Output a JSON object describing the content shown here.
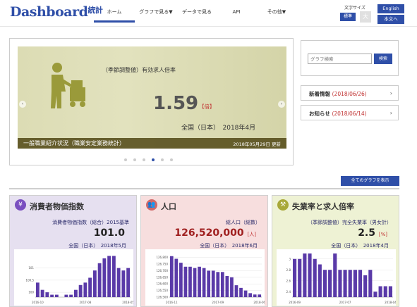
{
  "header": {
    "logo_text": "Dashboard",
    "logo_kanji": "統計",
    "nav": [
      "ホーム",
      "グラフで見る▼",
      "データで見る",
      "API",
      "その他▼"
    ],
    "font_size_label": "文字サイズ",
    "btn_standard": "標準",
    "btn_large": "大",
    "btn_english": "English",
    "btn_text": "本文へ"
  },
  "carousel": {
    "title": "（季節調整値）有効求人倍率",
    "value": "1.59",
    "unit": "【倍】",
    "region": "全国（日本）　2018年4月",
    "footer_left": "一般職業紹介状況（職業安定業務統計）",
    "footer_right": "2018年05月29日 更新",
    "prev_icon": "chevron-left-icon",
    "next_icon": "chevron-right-icon",
    "dots": 6,
    "active_dot": 3
  },
  "side": {
    "search_placeholder": "グラフ検索",
    "search_button": "検索",
    "news_label": "新着情報",
    "news_date": "(2018/06/26)",
    "notice_label": "お知らせ",
    "notice_date": "(2018/06/14)"
  },
  "all_graphs_button": "全てのグラフを表示",
  "cards": [
    {
      "title": "消費者物価指数",
      "icon": "yen-bag-icon",
      "subtitle": "消費者物価指数（総合）2015基準",
      "value": "101.0",
      "unit": "",
      "region": "全国（日本）　2018年5月",
      "bg": "#e6e0f0"
    },
    {
      "title": "人口",
      "icon": "people-icon",
      "subtitle": "総人口（総数）",
      "value": "126,520,000",
      "unit": "[人]",
      "region": "全国（日本）　2018年6月",
      "bg": "#f7dede"
    },
    {
      "title": "失業率と求人倍率",
      "icon": "worker-icon",
      "subtitle": "（季節調整値）完全失業率（男女計）",
      "value": "2.5",
      "unit": "[%]",
      "region": "全国（日本）　2018年4月",
      "bg": "#eef2d4"
    }
  ],
  "chart_data": [
    {
      "type": "bar",
      "x": [
        "2016-10",
        "2016-11",
        "2016-12",
        "2017-01",
        "2017-02",
        "2017-03",
        "2017-04",
        "2017-05",
        "2017-06",
        "2017-07",
        "2017-08",
        "2017-09",
        "2017-10",
        "2017-11",
        "2017-12",
        "2018-01",
        "2018-02",
        "2018-03",
        "2018-04",
        "2018-05"
      ],
      "tick_labels": [
        "2016-10",
        "2017-08",
        "2018-05"
      ],
      "y_ticks": [
        "100",
        "100.5",
        "101"
      ],
      "values": [
        100.4,
        100.1,
        100.0,
        99.9,
        99.9,
        99.8,
        99.9,
        99.9,
        100.1,
        100.3,
        100.4,
        100.6,
        100.9,
        101.2,
        101.4,
        101.5,
        101.5,
        101.0,
        100.9,
        101.0
      ],
      "ylim": [
        99.8,
        101.6
      ],
      "color": "#5a3aa8"
    },
    {
      "type": "bar",
      "x": [
        "2016-11",
        "2016-12",
        "2017-01",
        "2017-02",
        "2017-03",
        "2017-04",
        "2017-05",
        "2017-06",
        "2017-07",
        "2017-08",
        "2017-09",
        "2017-10",
        "2017-11",
        "2017-12",
        "2018-01",
        "2018-02",
        "2018-03",
        "2018-04",
        "2018-05",
        "2018-06"
      ],
      "tick_labels": [
        "2016-11",
        "2017-09",
        "2018-06"
      ],
      "y_ticks": [
        "126,500",
        "126,550",
        "126,600",
        "126,650",
        "126,700",
        "126,750",
        "126,800"
      ],
      "values": [
        126810,
        126790,
        126760,
        126730,
        126730,
        126720,
        126730,
        126720,
        126700,
        126700,
        126690,
        126690,
        126660,
        126650,
        126590,
        126570,
        126550,
        126530,
        126520,
        126520
      ],
      "ylim": [
        126500,
        126830
      ],
      "color": "#5a3aa8"
    },
    {
      "type": "bar",
      "x": [
        "2016-09",
        "2016-10",
        "2016-11",
        "2016-12",
        "2017-01",
        "2017-02",
        "2017-03",
        "2017-04",
        "2017-05",
        "2017-06",
        "2017-07",
        "2017-08",
        "2017-09",
        "2017-10",
        "2017-11",
        "2017-12",
        "2018-01",
        "2018-02",
        "2018-03",
        "2018-04"
      ],
      "tick_labels": [
        "2016-09",
        "2017-07",
        "2018-04"
      ],
      "y_ticks": [
        "2.4",
        "2.6",
        "2.8",
        "3"
      ],
      "values": [
        3.0,
        3.0,
        3.1,
        3.1,
        3.0,
        2.9,
        2.8,
        2.8,
        3.1,
        2.8,
        2.8,
        2.8,
        2.8,
        2.8,
        2.7,
        2.8,
        2.4,
        2.5,
        2.5,
        2.5
      ],
      "ylim": [
        2.3,
        3.1
      ],
      "color": "#5a3aa8"
    }
  ]
}
